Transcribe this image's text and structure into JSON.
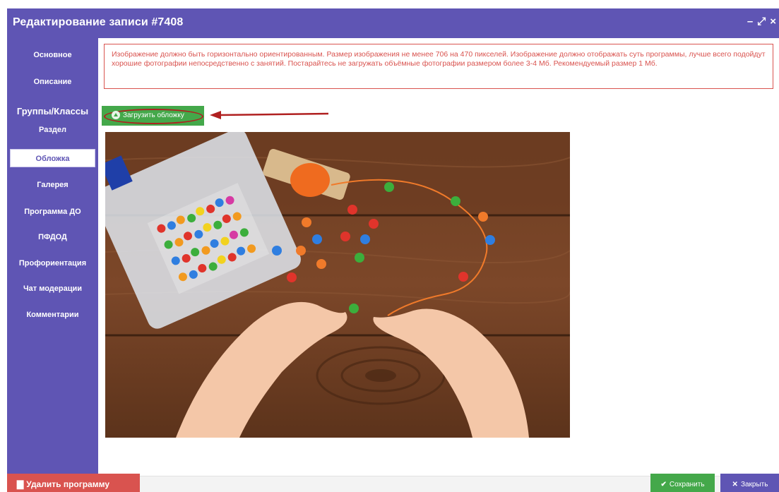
{
  "window": {
    "title": "Редактирование записи #7408",
    "minimize_icon": "–",
    "maximize_icon": "⤢",
    "close_icon": "×"
  },
  "sidebar": {
    "items": [
      {
        "label": "Основное",
        "state": "normal"
      },
      {
        "label": "Описание",
        "state": "normal"
      },
      {
        "label": "Группы/Классы",
        "state": "header"
      },
      {
        "label": "Раздел",
        "state": "normal"
      },
      {
        "label": "Обложка",
        "state": "active"
      },
      {
        "label": "Галерея",
        "state": "normal"
      },
      {
        "label": "Программа ДО",
        "state": "normal"
      },
      {
        "label": "ПФДОД",
        "state": "normal"
      },
      {
        "label": "Профориентация",
        "state": "normal"
      },
      {
        "label": "Чат модерации",
        "state": "normal"
      },
      {
        "label": "Комментарии",
        "state": "normal"
      }
    ]
  },
  "content": {
    "notice": "Изображение должно быть горизонтально ориентированным. Размер изображения не менее 706 на 470 пикселей. Изображение должно отображать суть программы, лучше всего подойдут хорошие фотографии непосредственно с занятий. Постарайтесь не загружать объёмные фотографии размером более 3-4 Мб. Рекомендуемый размер 1 Мб.",
    "upload_button_label": "Загрузить обложку",
    "cover_image": "photo-child-hands-stringing-colorful-beads-on-wooden-table"
  },
  "footer": {
    "delete_label": "Удалить программу",
    "save_label": "Сохранить",
    "close_label": "Закрыть"
  },
  "colors": {
    "brand": "#5f55b4",
    "success": "#44a84a",
    "danger": "#d9534f"
  }
}
